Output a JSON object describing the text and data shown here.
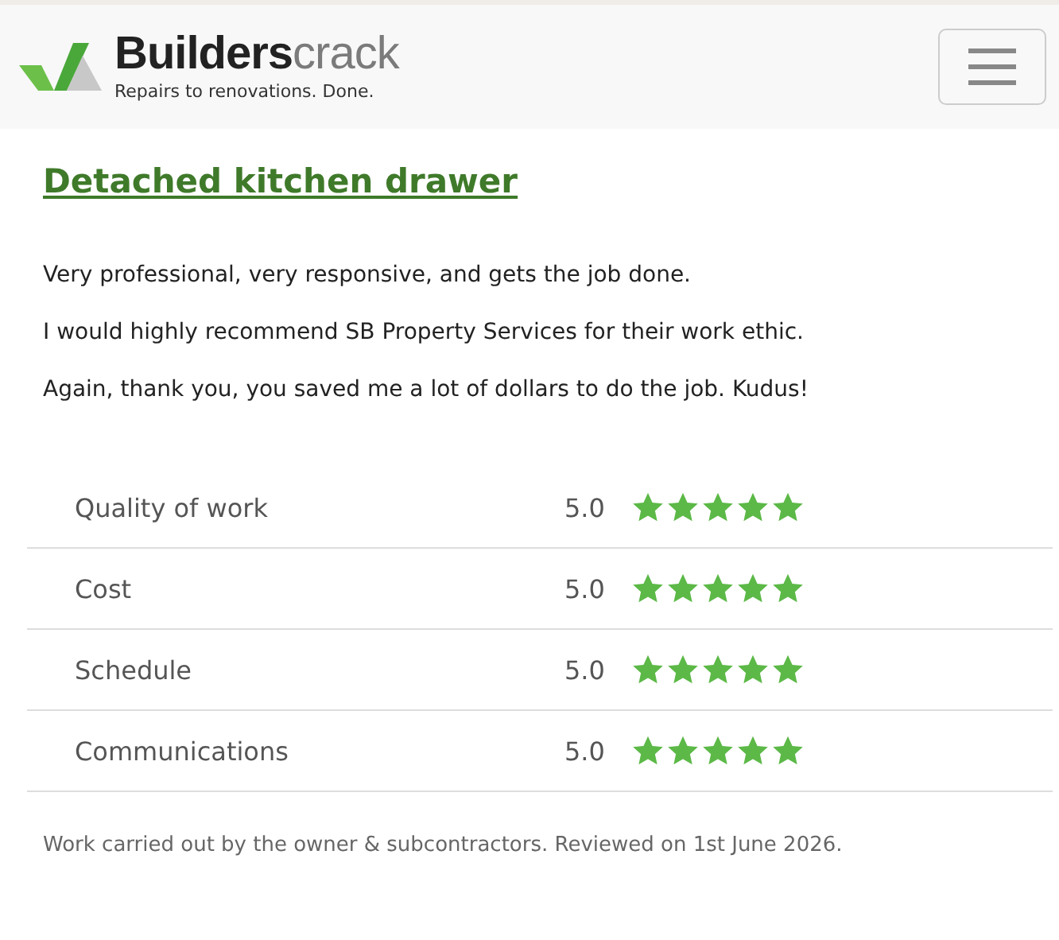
{
  "header": {
    "brand_dark": "Builders",
    "brand_light": "crack",
    "tagline": "Repairs to renovations. Done."
  },
  "review": {
    "title": "Detached kitchen drawer",
    "paragraphs": [
      "Very professional, very responsive, and gets the job done.",
      "I would highly recommend SB Property Services for their work ethic.",
      "Again, thank you, you saved me a lot of dollars to do the job. Kudus!"
    ]
  },
  "ratings": [
    {
      "label": "Quality of work",
      "score": "5.0",
      "stars": 5
    },
    {
      "label": "Cost",
      "score": "5.0",
      "stars": 5
    },
    {
      "label": "Schedule",
      "score": "5.0",
      "stars": 5
    },
    {
      "label": "Communications",
      "score": "5.0",
      "stars": 5
    }
  ],
  "footer": "Work carried out by the owner & subcontractors. Reviewed on 1st June 2026."
}
